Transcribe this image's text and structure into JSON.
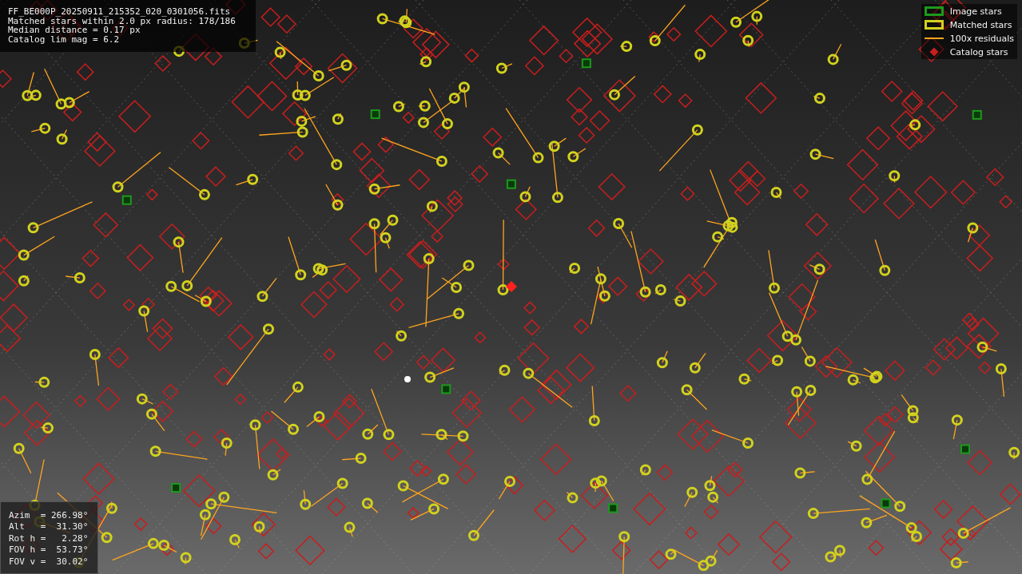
{
  "info": {
    "lines": [
      "FF_BE000P_20250911_215352_020_0301056.fits",
      "Matched stars within 2.0 px radius: 178/186",
      "Median distance = 0.17 px",
      "Catalog lim mag = 6.2"
    ]
  },
  "legend": [
    {
      "label": "Image stars",
      "kind": "box",
      "color": "#1c9a1c"
    },
    {
      "label": "Matched stars",
      "kind": "box",
      "color": "#d2d21e"
    },
    {
      "label": "100x residuals",
      "kind": "line",
      "color": "#ffa51e"
    },
    {
      "label": "Catalog stars",
      "kind": "diamond",
      "color": "#c81e1e"
    }
  ],
  "pointing": {
    "lines": [
      "Azim  = 266.98°",
      "Alt   =  31.30°",
      "Rot h =   2.28°",
      "FOV h =  53.73°",
      "FOV v =  30.02°"
    ]
  }
}
